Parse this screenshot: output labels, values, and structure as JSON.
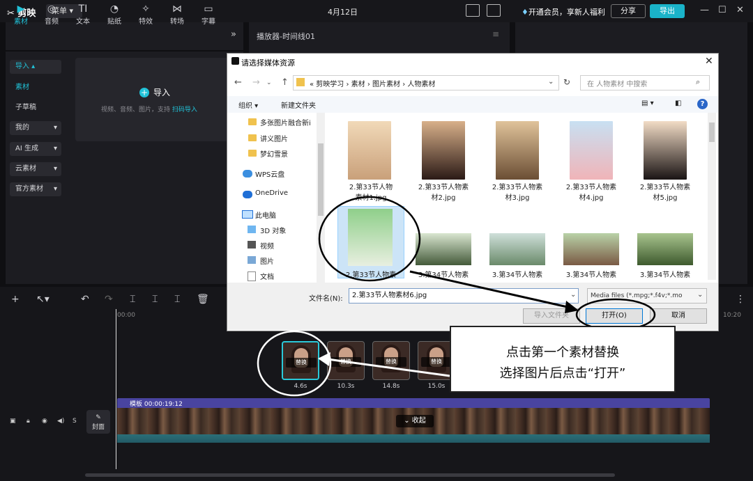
{
  "app": {
    "name": "剪映",
    "menu_label": "菜单",
    "date": "4月12日",
    "vip_text": "开通会员，享新人福利",
    "share_label": "分享",
    "export_label": "导出"
  },
  "toolbar": {
    "items": [
      {
        "label": "素材",
        "icon": "media-icon"
      },
      {
        "label": "音频",
        "icon": "audio-icon"
      },
      {
        "label": "文本",
        "icon": "text-icon"
      },
      {
        "label": "贴纸",
        "icon": "sticker-icon"
      },
      {
        "label": "特效",
        "icon": "effects-icon"
      },
      {
        "label": "转场",
        "icon": "transition-icon"
      },
      {
        "label": "字幕",
        "icon": "subtitle-icon"
      }
    ]
  },
  "sidebar": {
    "items": [
      {
        "label": "导入"
      },
      {
        "label": "素材"
      },
      {
        "label": "子草稿"
      },
      {
        "label": "我的"
      },
      {
        "label": "AI 生成"
      },
      {
        "label": "云素材"
      },
      {
        "label": "官方素材"
      }
    ]
  },
  "import_panel": {
    "button": "导入",
    "hint": "视频、音频、图片，支持",
    "hint_link": "扫码导入"
  },
  "player": {
    "title": "播放器-时间线01"
  },
  "timeline": {
    "ruler_start": "00:00",
    "ruler_end": "10:20",
    "clips": [
      {
        "duration": "4.6s",
        "replace": "替换"
      },
      {
        "duration": "10.3s",
        "replace": "替换"
      },
      {
        "duration": "14.8s",
        "replace": "替换"
      },
      {
        "duration": "15.0s",
        "replace": "替换"
      }
    ],
    "track_label": "模板",
    "track_time": "00:00:19:12",
    "collapse": "收起",
    "cover": "封面"
  },
  "dialog": {
    "title": "请选择媒体资源",
    "breadcrumb": [
      "剪映学习",
      "素材",
      "图片素材",
      "人物素材"
    ],
    "search_placeholder": "在 人物素材 中搜索",
    "organize": "组织",
    "new_folder": "新建文件夹",
    "tree": [
      {
        "label": "多张图片融合新i",
        "icon": "folder-icon"
      },
      {
        "label": "讲义图片",
        "icon": "folder-icon"
      },
      {
        "label": "梦幻雪景",
        "icon": "folder-icon"
      },
      {
        "label": "WPS云盘",
        "icon": "cloud-icon"
      },
      {
        "label": "OneDrive",
        "icon": "onedrive-icon"
      },
      {
        "label": "此电脑",
        "icon": "pc-icon"
      },
      {
        "label": "3D 对象",
        "icon": "cube-icon"
      },
      {
        "label": "视频",
        "icon": "video-icon"
      },
      {
        "label": "图片",
        "icon": "image-icon"
      },
      {
        "label": "文档",
        "icon": "document-icon"
      }
    ],
    "files_row1": [
      {
        "line1": "2.第33节人物",
        "line2": "素材1.jpg"
      },
      {
        "line1": "2.第33节人物素",
        "line2": "材2.jpg"
      },
      {
        "line1": "2.第33节人物素",
        "line2": "材3.jpg"
      },
      {
        "line1": "2.第33节人物素",
        "line2": "材4.jpg"
      },
      {
        "line1": "2.第33节人物素",
        "line2": "材5.jpg"
      }
    ],
    "files_row2": [
      {
        "name": "2.第33节人物素"
      },
      {
        "name": "3.第34节人物素"
      },
      {
        "name": "3.第34节人物素"
      },
      {
        "name": "3.第34节人物素"
      },
      {
        "name": "3.第34节人物素"
      }
    ],
    "filename_label": "文件名(N):",
    "filename_value": "2.第33节人物素材6.jpg",
    "filter_value": "Media files (*.mpg;*.f4v;*.mo",
    "import_folder": "导入文件夹",
    "open": "打开(O)",
    "cancel": "取消"
  },
  "annotation": {
    "line1": "点击第一个素材替换",
    "line2": "选择图片后点击“打开”"
  }
}
